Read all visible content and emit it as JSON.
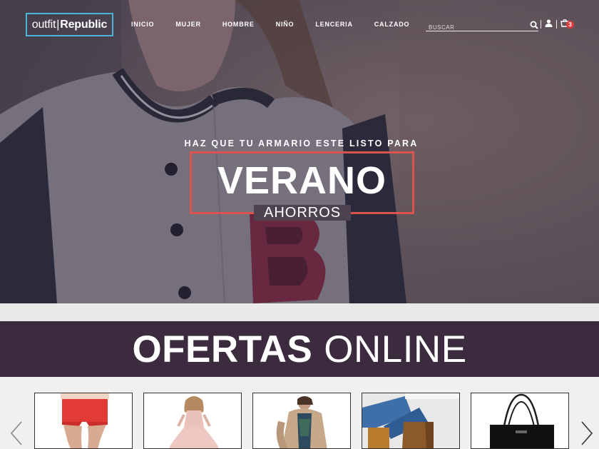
{
  "brand": {
    "logo_thin": "outfit",
    "logo_bar": "|",
    "logo_bold": "Republic",
    "accent": "#4fb3d9"
  },
  "nav": {
    "items": [
      "INICIO",
      "MUJER",
      "HOMBRE",
      "NIÑO",
      "LENCERIA",
      "CALZADO"
    ]
  },
  "search": {
    "placeholder": "BUSCAR",
    "value": ""
  },
  "icons": {
    "search": "search-icon",
    "user": "user-icon",
    "cart": "cart-icon"
  },
  "cart": {
    "count": "3",
    "badge_color": "#e03a3e"
  },
  "hero": {
    "tagline": "HAZ QUE TU ARMARIO ESTE LISTO PARA",
    "season": "VERANO",
    "subtitle": "AHORROS",
    "frame_color": "#d9534f"
  },
  "offers": {
    "title_strong": "OFERTAS",
    "title_light": "ONLINE",
    "band_color": "#3c2b3e"
  },
  "carousel": {
    "prev": "‹",
    "next": "›",
    "products": [
      "red-shorts",
      "pink-girl-dress",
      "fur-coat",
      "cowboy-boots",
      "black-handbag"
    ]
  }
}
